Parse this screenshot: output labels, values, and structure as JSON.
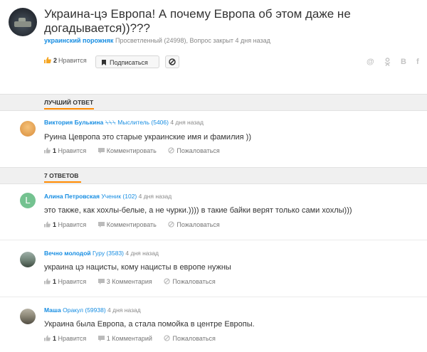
{
  "question": {
    "title": "Украина-цэ Европа! А почему Европа об этом даже не догадывается))???",
    "author": "украинский порожняк",
    "author_status": "Просветленный (24998)",
    "meta_suffix": ", Вопрос закрыт 4 дня назад",
    "likes_count": "2",
    "likes_label": "Нравится",
    "subscribe_label": "Подписаться",
    "share_icons": [
      "@",
      "ok",
      "B",
      "f"
    ]
  },
  "best_section": {
    "label": "ЛУЧШИЙ ОТВЕТ"
  },
  "answers_section": {
    "label": "7 ОТВЕТОВ"
  },
  "best_answer": {
    "author": "Виктория Булькина",
    "suffix": "⍀⍀⍀",
    "status": "Мыслитель (5406)",
    "time": "4 дня назад",
    "text": "Руина Цевропа это старые украинские имя и фамилия ))",
    "likes": "1",
    "likes_label": "Нравится",
    "comment_label": "Комментировать",
    "report_label": "Пожаловаться"
  },
  "answers": [
    {
      "author": "Алина Петровская",
      "status": "Ученик (102)",
      "time": "4 дня назад",
      "avatar_letter": "L",
      "text": "это также, как хохлы-белые, а не чурки.)))) в такие байки верят только сами хохлы)))",
      "likes": "1",
      "likes_label": "Нравится",
      "comment_label": "Комментировать",
      "report_label": "Пожаловаться"
    },
    {
      "author": "Вечно молодой",
      "status": "Гуру (3583)",
      "time": "4 дня назад",
      "text": "украина цэ нацисты, кому нацисты в европе нужны",
      "likes": "1",
      "likes_label": "Нравится",
      "comment_label": "3 Комментария",
      "report_label": "Пожаловаться"
    },
    {
      "author": "Маша",
      "status": "Оракул (59938)",
      "time": "4 дня назад",
      "text": "Украина была Европа, а стала помойка в центре Европы.",
      "likes": "1",
      "likes_label": "Нравится",
      "comment_label": "1 Комментарий",
      "report_label": "Пожаловаться"
    }
  ],
  "colors": {
    "link": "#168de2",
    "accent": "#ff8a00",
    "like": "#f5a623"
  }
}
